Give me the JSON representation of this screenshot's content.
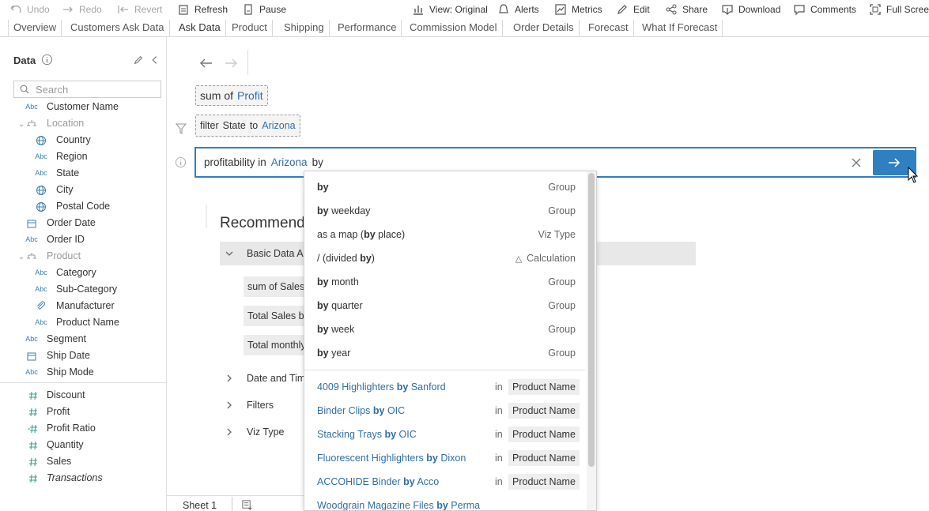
{
  "toolbar": {
    "undo": "Undo",
    "redo": "Redo",
    "revert": "Revert",
    "refresh": "Refresh",
    "pause": "Pause",
    "view": "View: Original",
    "alerts": "Alerts",
    "metrics": "Metrics",
    "edit": "Edit",
    "share": "Share",
    "download": "Download",
    "comments": "Comments",
    "fullscreen": "Full Scree"
  },
  "tabs": [
    "Overview",
    "Customers Ask Data",
    "Ask Data",
    "Product",
    "Shipping",
    "Performance",
    "Commission Model",
    "Order Details",
    "Forecast",
    "What If Forecast"
  ],
  "datapane": {
    "title": "Data",
    "search_placeholder": "Search",
    "fields": [
      {
        "icon": "Abc",
        "label": "Customer Name"
      },
      {
        "icon": "hier",
        "label": "Location",
        "group": true
      },
      {
        "icon": "globe",
        "label": "Country"
      },
      {
        "icon": "Abc",
        "label": "Region"
      },
      {
        "icon": "Abc",
        "label": "State"
      },
      {
        "icon": "globe",
        "label": "City"
      },
      {
        "icon": "globe",
        "label": "Postal Code"
      },
      {
        "icon": "cal",
        "label": "Order Date"
      },
      {
        "icon": "Abc",
        "label": "Order ID"
      },
      {
        "icon": "hier",
        "label": "Product",
        "group": true
      },
      {
        "icon": "Abc",
        "label": "Category"
      },
      {
        "icon": "Abc",
        "label": "Sub-Category"
      },
      {
        "icon": "clip",
        "label": "Manufacturer"
      },
      {
        "icon": "Abc",
        "label": "Product Name"
      },
      {
        "icon": "Abc",
        "label": "Segment"
      },
      {
        "icon": "cal",
        "label": "Ship Date"
      },
      {
        "icon": "Abc",
        "label": "Ship Mode"
      }
    ],
    "measures": [
      "Discount",
      "Profit",
      "Profit Ratio",
      "Quantity",
      "Sales",
      "Transactions"
    ]
  },
  "main": {
    "sum_pill": {
      "prefix": "sum of",
      "field": "Profit"
    },
    "filter_pill": {
      "prefix": "filter",
      "field": "State",
      "to": "to",
      "value": "Arizona"
    },
    "query": {
      "part1": "profitability in",
      "part2": "Arizona",
      "part3": "by"
    },
    "recommended_title": "Recommende",
    "basic_data": "Basic Data Ar",
    "rec_items": [
      "sum of Sales",
      "Total Sales by",
      "Total monthly"
    ],
    "sections": [
      "Date and Tim",
      "Filters",
      "Viz Type"
    ],
    "sheet": "Sheet 1"
  },
  "dropdown": {
    "suggestions": [
      {
        "bold": "by",
        "rest": "",
        "type": "Group"
      },
      {
        "bold": "by",
        "rest": " weekday",
        "type": "Group"
      },
      {
        "pre": "as a map   (",
        "bold": "by",
        "rest": " place)",
        "type": "Viz Type"
      },
      {
        "pre": "/   (divided ",
        "bold": "by",
        "rest": ")",
        "type": "Calculation"
      },
      {
        "bold": "by",
        "rest": " month",
        "type": "Group"
      },
      {
        "bold": "by",
        "rest": " quarter",
        "type": "Group"
      },
      {
        "bold": "by",
        "rest": " week",
        "type": "Group"
      },
      {
        "bold": "by",
        "rest": " year",
        "type": "Group"
      }
    ],
    "values": [
      {
        "a": "4009 Highlighters ",
        "b": "by",
        "c": " Sanford"
      },
      {
        "a": "Binder Clips ",
        "b": "by",
        "c": " OIC"
      },
      {
        "a": "Stacking Trays ",
        "b": "by",
        "c": " OIC"
      },
      {
        "a": "Fluorescent Highlighters ",
        "b": "by",
        "c": " Dixon"
      },
      {
        "a": "ACCOHIDE Binder ",
        "b": "by",
        "c": " Acco"
      },
      {
        "a": "Woodgrain Magazine Files ",
        "b": "by",
        "c": " Perma"
      }
    ],
    "in_label": "in",
    "tag_label": "Product Name"
  },
  "colors": {
    "accent": "#2f7fc1",
    "link": "#2f6ea8"
  }
}
